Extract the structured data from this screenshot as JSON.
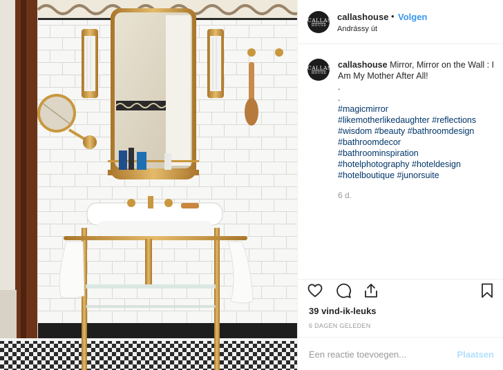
{
  "post": {
    "username": "callashouse",
    "follow_label": "Volgen",
    "separator": "•",
    "location": "Andrássy út",
    "avatar": {
      "line1": "CALLAS",
      "line2": "HOUSE"
    }
  },
  "caption": {
    "username": "callashouse",
    "text": "Mirror, Mirror on the Wall : I Am My Mother After All!",
    "dot1": ".",
    "dot2": ".",
    "hashtags": [
      "#magicmirror",
      "#likemotherlikedaughter",
      "#reflections",
      "#wisdom",
      "#beauty",
      "#bathroomdesign",
      "#bathroomdecor",
      "#bathroominspiration",
      "#hotelphotography",
      "#hoteldesign",
      "#hotelboutique",
      "#junorsuite"
    ],
    "time_ago": "6 d."
  },
  "actions": {
    "icons": [
      "heart-icon",
      "comment-icon",
      "share-icon",
      "bookmark-icon"
    ],
    "likes": "39 vind-ik-leuks",
    "date": "6 DAGEN GELEDEN"
  },
  "comment_box": {
    "placeholder": "Een reactie toevoegen...",
    "post_label": "Plaatsen"
  },
  "colors": {
    "link_blue": "#3897f0",
    "hashtag": "#003569",
    "muted": "#999999",
    "post_button_disabled": "#b2dffc",
    "border": "#efefef",
    "brass": "#c9973e"
  }
}
